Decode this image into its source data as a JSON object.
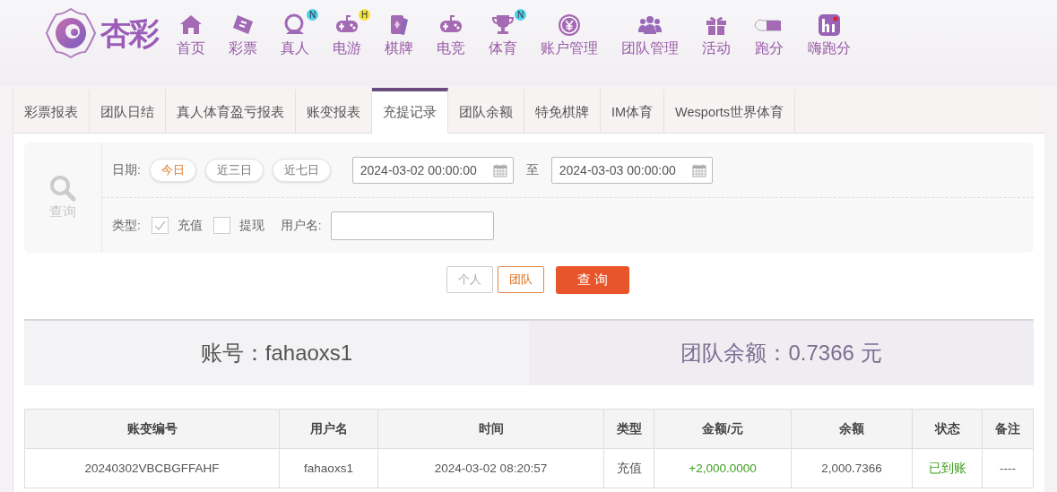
{
  "brand": {
    "name": "杏彩"
  },
  "nav": [
    {
      "label": "首页"
    },
    {
      "label": "彩票"
    },
    {
      "label": "真人",
      "badge": {
        "text": "N",
        "color": "#4fd0ee"
      }
    },
    {
      "label": "电游",
      "badge": {
        "text": "H",
        "color": "#f3e23a"
      }
    },
    {
      "label": "棋牌"
    },
    {
      "label": "电竞"
    },
    {
      "label": "体育",
      "badge": {
        "text": "N",
        "color": "#4fd0ee"
      }
    },
    {
      "label": "账户管理"
    },
    {
      "label": "团队管理"
    },
    {
      "label": "活动"
    },
    {
      "label": "跑分"
    },
    {
      "label": "嗨跑分"
    }
  ],
  "tabs": [
    {
      "label": "彩票报表",
      "selected": false
    },
    {
      "label": "团队日结",
      "selected": false
    },
    {
      "label": "真人体育盈亏报表",
      "selected": false
    },
    {
      "label": "账变报表",
      "selected": false
    },
    {
      "label": "充提记录",
      "selected": true
    },
    {
      "label": "团队余额",
      "selected": false
    },
    {
      "label": "特免棋牌",
      "selected": false
    },
    {
      "label": "IM体育",
      "selected": false
    },
    {
      "label": "Wesports世界体育",
      "selected": false
    }
  ],
  "filter": {
    "search_label": "查询",
    "date_label": "日期:",
    "quick_dates": [
      {
        "label": "今日",
        "selected": true
      },
      {
        "label": "近三日",
        "selected": false
      },
      {
        "label": "近七日",
        "selected": false
      }
    ],
    "start": "2024-03-02 00:00:00",
    "separator": "至",
    "end": "2024-03-03 00:00:00",
    "type_label": "类型:",
    "types": [
      {
        "label": "充值",
        "checked": true
      },
      {
        "label": "提现",
        "checked": false
      }
    ],
    "username_label": "用户名:"
  },
  "scope": [
    {
      "label": "个人",
      "selected": false
    },
    {
      "label": "团队",
      "selected": true
    }
  ],
  "submit": "查 询",
  "summary": {
    "account": "账号：fahaoxs1",
    "balance": "团队余额：0.7366 元"
  },
  "table": {
    "columns": [
      "账变编号",
      "用户名",
      "时间",
      "类型",
      "金额/元",
      "余额",
      "状态",
      "备注"
    ],
    "rows": [
      {
        "id": "20240302VBCBGFFAHF",
        "user": "fahaoxs1",
        "time": "2024-03-02 08:20:57",
        "type": "充值",
        "amount": "+2,000.0000",
        "balance": "2,000.7366",
        "status": "已到账",
        "note": "----"
      }
    ]
  }
}
